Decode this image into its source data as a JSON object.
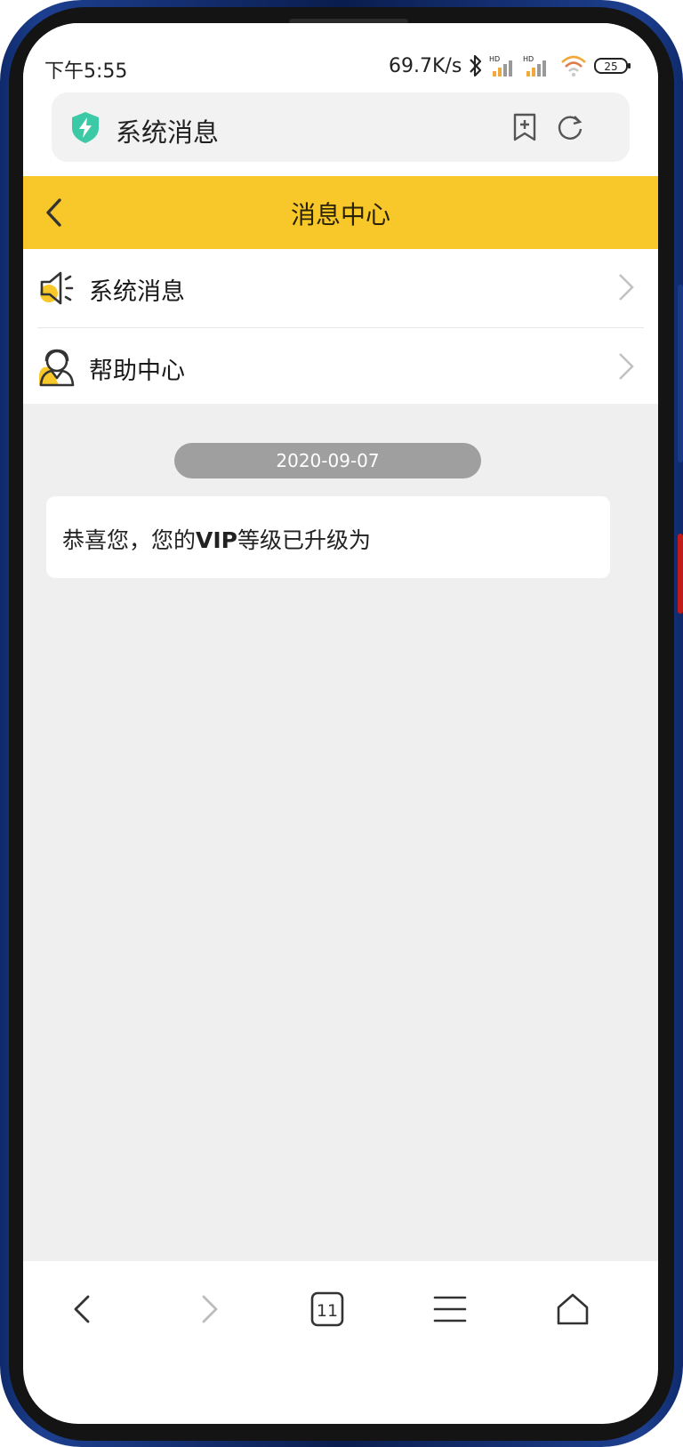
{
  "status_bar": {
    "time": "下午5:55",
    "net_speed": "69.7K/s",
    "battery": "25",
    "icons": [
      "bluetooth-icon",
      "signal-hd-icon",
      "signal-hd-icon",
      "wifi-icon",
      "battery-icon"
    ]
  },
  "browser": {
    "page_title": "系统消息",
    "icons": [
      "shield-icon",
      "bookmark-add-icon",
      "refresh-icon"
    ]
  },
  "header": {
    "title": "消息中心",
    "accent_color": "#f8c82a"
  },
  "menu": {
    "items": [
      {
        "label": "系统消息",
        "icon": "speaker-icon"
      },
      {
        "label": "帮助中心",
        "icon": "support-agent-icon"
      }
    ]
  },
  "messages": {
    "date": "2020-09-07",
    "text_prefix": "恭喜您，您的",
    "text_bold": "VIP",
    "text_suffix": "等级已升级为"
  },
  "bottom_nav": {
    "tab_count": "11",
    "icons": [
      "back-icon",
      "forward-icon",
      "tabs-icon",
      "menu-icon",
      "home-icon"
    ]
  }
}
